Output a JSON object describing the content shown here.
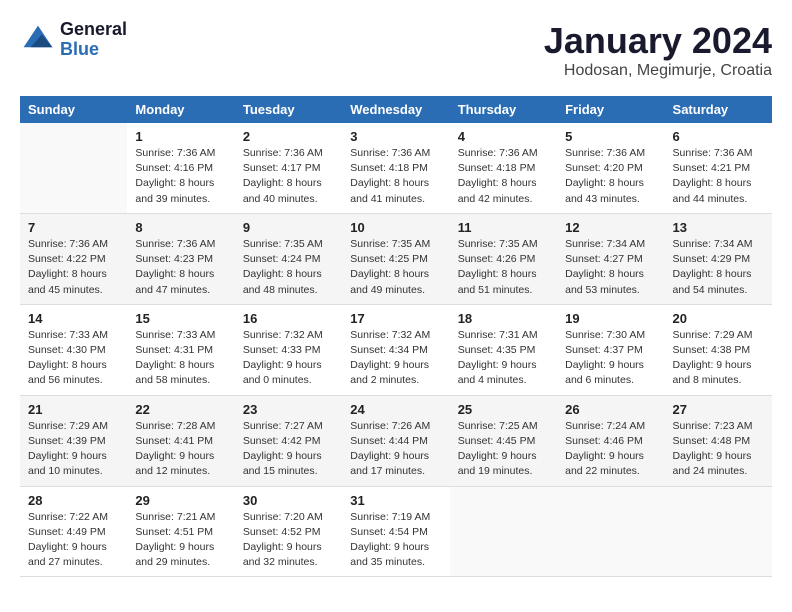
{
  "header": {
    "logo_line1": "General",
    "logo_line2": "Blue",
    "main_title": "January 2024",
    "sub_title": "Hodosan, Megimurje, Croatia"
  },
  "calendar": {
    "days_of_week": [
      "Sunday",
      "Monday",
      "Tuesday",
      "Wednesday",
      "Thursday",
      "Friday",
      "Saturday"
    ],
    "weeks": [
      [
        {
          "day": "",
          "info": ""
        },
        {
          "day": "1",
          "info": "Sunrise: 7:36 AM\nSunset: 4:16 PM\nDaylight: 8 hours\nand 39 minutes."
        },
        {
          "day": "2",
          "info": "Sunrise: 7:36 AM\nSunset: 4:17 PM\nDaylight: 8 hours\nand 40 minutes."
        },
        {
          "day": "3",
          "info": "Sunrise: 7:36 AM\nSunset: 4:18 PM\nDaylight: 8 hours\nand 41 minutes."
        },
        {
          "day": "4",
          "info": "Sunrise: 7:36 AM\nSunset: 4:18 PM\nDaylight: 8 hours\nand 42 minutes."
        },
        {
          "day": "5",
          "info": "Sunrise: 7:36 AM\nSunset: 4:20 PM\nDaylight: 8 hours\nand 43 minutes."
        },
        {
          "day": "6",
          "info": "Sunrise: 7:36 AM\nSunset: 4:21 PM\nDaylight: 8 hours\nand 44 minutes."
        }
      ],
      [
        {
          "day": "7",
          "info": "Sunrise: 7:36 AM\nSunset: 4:22 PM\nDaylight: 8 hours\nand 45 minutes."
        },
        {
          "day": "8",
          "info": "Sunrise: 7:36 AM\nSunset: 4:23 PM\nDaylight: 8 hours\nand 47 minutes."
        },
        {
          "day": "9",
          "info": "Sunrise: 7:35 AM\nSunset: 4:24 PM\nDaylight: 8 hours\nand 48 minutes."
        },
        {
          "day": "10",
          "info": "Sunrise: 7:35 AM\nSunset: 4:25 PM\nDaylight: 8 hours\nand 49 minutes."
        },
        {
          "day": "11",
          "info": "Sunrise: 7:35 AM\nSunset: 4:26 PM\nDaylight: 8 hours\nand 51 minutes."
        },
        {
          "day": "12",
          "info": "Sunrise: 7:34 AM\nSunset: 4:27 PM\nDaylight: 8 hours\nand 53 minutes."
        },
        {
          "day": "13",
          "info": "Sunrise: 7:34 AM\nSunset: 4:29 PM\nDaylight: 8 hours\nand 54 minutes."
        }
      ],
      [
        {
          "day": "14",
          "info": "Sunrise: 7:33 AM\nSunset: 4:30 PM\nDaylight: 8 hours\nand 56 minutes."
        },
        {
          "day": "15",
          "info": "Sunrise: 7:33 AM\nSunset: 4:31 PM\nDaylight: 8 hours\nand 58 minutes."
        },
        {
          "day": "16",
          "info": "Sunrise: 7:32 AM\nSunset: 4:33 PM\nDaylight: 9 hours\nand 0 minutes."
        },
        {
          "day": "17",
          "info": "Sunrise: 7:32 AM\nSunset: 4:34 PM\nDaylight: 9 hours\nand 2 minutes."
        },
        {
          "day": "18",
          "info": "Sunrise: 7:31 AM\nSunset: 4:35 PM\nDaylight: 9 hours\nand 4 minutes."
        },
        {
          "day": "19",
          "info": "Sunrise: 7:30 AM\nSunset: 4:37 PM\nDaylight: 9 hours\nand 6 minutes."
        },
        {
          "day": "20",
          "info": "Sunrise: 7:29 AM\nSunset: 4:38 PM\nDaylight: 9 hours\nand 8 minutes."
        }
      ],
      [
        {
          "day": "21",
          "info": "Sunrise: 7:29 AM\nSunset: 4:39 PM\nDaylight: 9 hours\nand 10 minutes."
        },
        {
          "day": "22",
          "info": "Sunrise: 7:28 AM\nSunset: 4:41 PM\nDaylight: 9 hours\nand 12 minutes."
        },
        {
          "day": "23",
          "info": "Sunrise: 7:27 AM\nSunset: 4:42 PM\nDaylight: 9 hours\nand 15 minutes."
        },
        {
          "day": "24",
          "info": "Sunrise: 7:26 AM\nSunset: 4:44 PM\nDaylight: 9 hours\nand 17 minutes."
        },
        {
          "day": "25",
          "info": "Sunrise: 7:25 AM\nSunset: 4:45 PM\nDaylight: 9 hours\nand 19 minutes."
        },
        {
          "day": "26",
          "info": "Sunrise: 7:24 AM\nSunset: 4:46 PM\nDaylight: 9 hours\nand 22 minutes."
        },
        {
          "day": "27",
          "info": "Sunrise: 7:23 AM\nSunset: 4:48 PM\nDaylight: 9 hours\nand 24 minutes."
        }
      ],
      [
        {
          "day": "28",
          "info": "Sunrise: 7:22 AM\nSunset: 4:49 PM\nDaylight: 9 hours\nand 27 minutes."
        },
        {
          "day": "29",
          "info": "Sunrise: 7:21 AM\nSunset: 4:51 PM\nDaylight: 9 hours\nand 29 minutes."
        },
        {
          "day": "30",
          "info": "Sunrise: 7:20 AM\nSunset: 4:52 PM\nDaylight: 9 hours\nand 32 minutes."
        },
        {
          "day": "31",
          "info": "Sunrise: 7:19 AM\nSunset: 4:54 PM\nDaylight: 9 hours\nand 35 minutes."
        },
        {
          "day": "",
          "info": ""
        },
        {
          "day": "",
          "info": ""
        },
        {
          "day": "",
          "info": ""
        }
      ]
    ]
  }
}
